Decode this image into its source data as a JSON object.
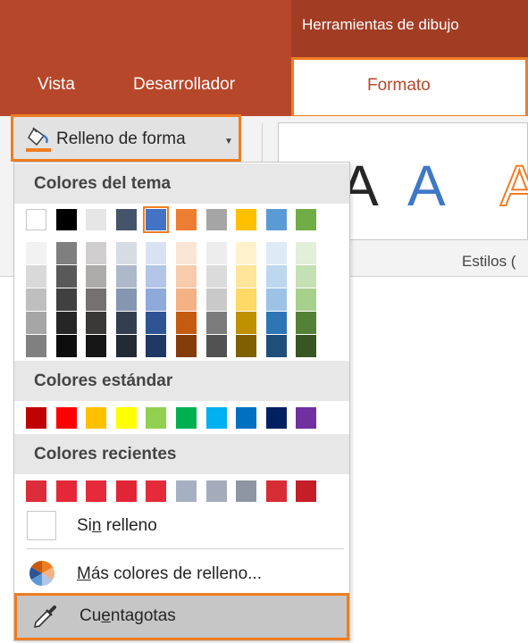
{
  "ribbon": {
    "context_header": "Herramientas de dibujo",
    "tabs": [
      {
        "label": "Vista"
      },
      {
        "label": "Desarrollador"
      },
      {
        "label": "Formato"
      }
    ],
    "styles_group_label": "Estilos (",
    "style_letter": "A",
    "colors": {
      "ribbon": "#b7472a",
      "accent": "#ef7d22",
      "wordart_blue": "#3e78c7"
    }
  },
  "fill_button": {
    "label": "Relleno de forma",
    "icon": "paint-bucket-icon",
    "arrow_icon": "dropdown-arrow-icon"
  },
  "dropdown": {
    "theme_colors_title": "Colores del tema",
    "theme_colors": [
      "#ffffff",
      "#000000",
      "#e7e6e6",
      "#44546a",
      "#4472c4",
      "#ed7d31",
      "#a5a5a5",
      "#ffc000",
      "#5b9bd5",
      "#70ad47"
    ],
    "selected_theme_color": "#4472c4",
    "theme_shades": [
      [
        "#f2f2f2",
        "#d9d9d9",
        "#bfbfbf",
        "#a6a6a6",
        "#808080"
      ],
      [
        "#7f7f7f",
        "#595959",
        "#404040",
        "#262626",
        "#0d0d0d"
      ],
      [
        "#d0cece",
        "#aeabab",
        "#757171",
        "#3b3838",
        "#171616"
      ],
      [
        "#d6dce4",
        "#adb9ca",
        "#8496b0",
        "#333f50",
        "#222a35"
      ],
      [
        "#d9e2f3",
        "#b4c6e7",
        "#8eaadb",
        "#2f5496",
        "#1f3864"
      ],
      [
        "#fbe5d5",
        "#f7cbac",
        "#f4b183",
        "#c55a11",
        "#843c0b"
      ],
      [
        "#ededed",
        "#dbdbdb",
        "#c9c9c9",
        "#7b7b7b",
        "#525252"
      ],
      [
        "#fff2cc",
        "#fee599",
        "#ffd965",
        "#bf9000",
        "#7f6000"
      ],
      [
        "#deebf6",
        "#bdd7ee",
        "#9cc3e5",
        "#2e75b5",
        "#1e4e79"
      ],
      [
        "#e2efd9",
        "#c5e0b3",
        "#a8d08d",
        "#538135",
        "#375623"
      ]
    ],
    "standard_colors_title": "Colores estándar",
    "standard_colors": [
      "#c00000",
      "#ff0000",
      "#ffc000",
      "#ffff00",
      "#92d050",
      "#00b050",
      "#00b0f0",
      "#0070c0",
      "#002060",
      "#7030a0"
    ],
    "recent_colors_title": "Colores recientes",
    "recent_colors": [
      "#dc2e3a",
      "#e42838",
      "#e52a3a",
      "#e12537",
      "#e52b3a",
      "#a5b1c2",
      "#a4acbc",
      "#8f96a3",
      "#d62d36",
      "#c41e26"
    ],
    "no_fill": {
      "prefix": "Si",
      "accel": "n",
      "suffix": " relleno"
    },
    "more_colors": {
      "prefix": "",
      "accel": "M",
      "suffix": "ás colores de relleno...",
      "icon": "color-wheel-icon"
    },
    "eyedropper": {
      "prefix": "Cu",
      "accel": "e",
      "suffix": "ntagotas",
      "icon": "eyedropper-icon"
    }
  }
}
